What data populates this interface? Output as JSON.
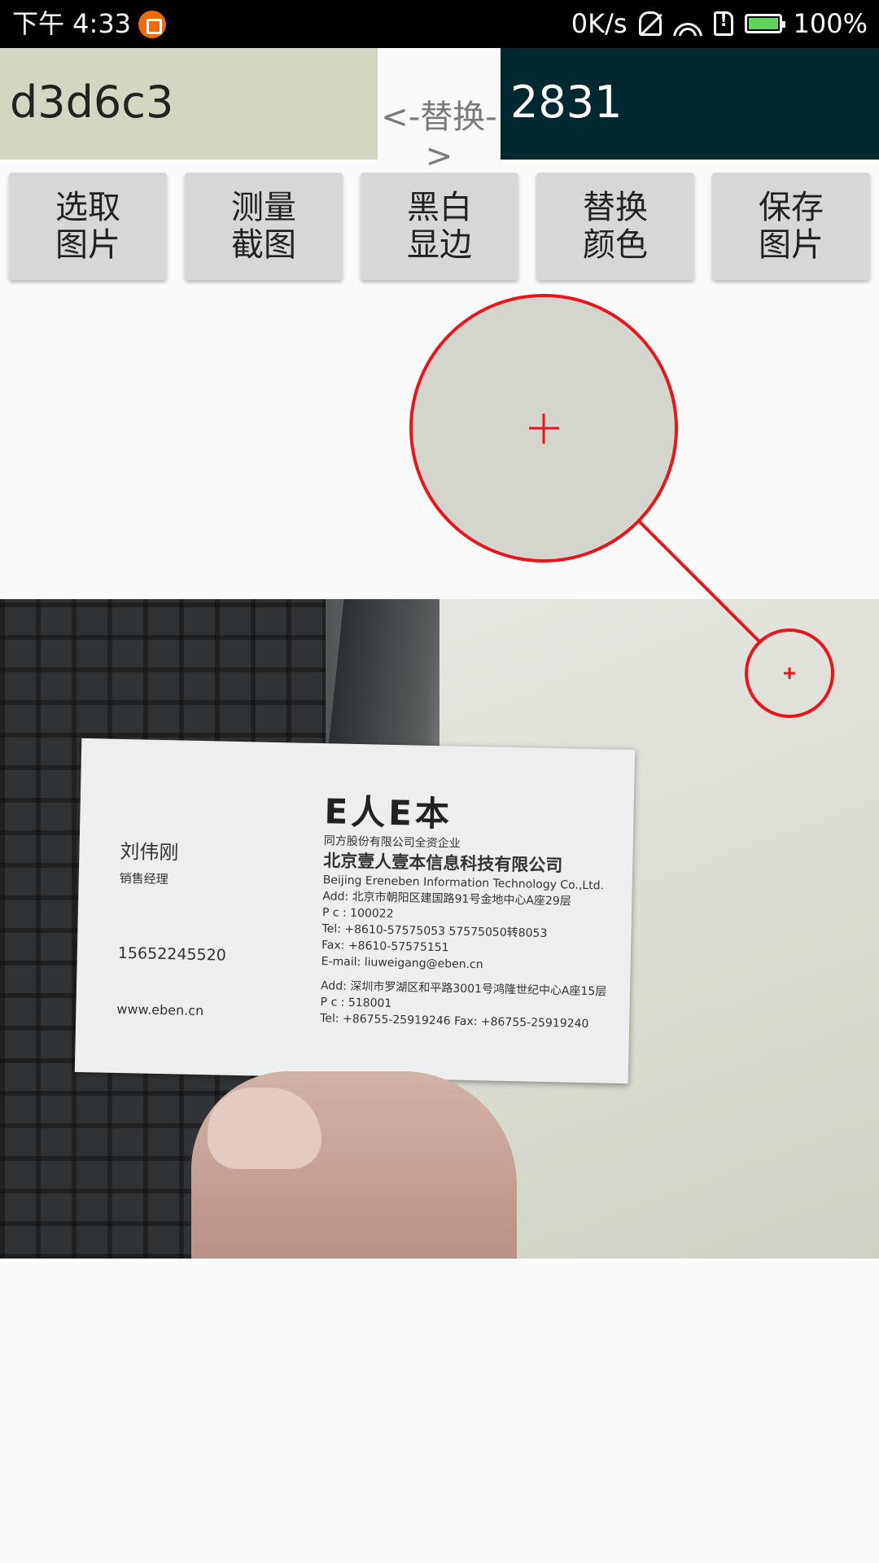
{
  "status_bar": {
    "time": "下午 4:33",
    "net_speed": "0K/s",
    "battery": "100%",
    "battery_level": 1.0,
    "icons": [
      "app-notification-icon",
      "bell-muted-icon",
      "wifi-icon",
      "sim-alert-icon",
      "battery-icon"
    ]
  },
  "colors": {
    "source_hex": "d3d6c3",
    "target_hex": "2831",
    "swap_label": "<-替换->",
    "source_color": "#d3d6c3",
    "target_color": "#002831"
  },
  "toolbar": {
    "buttons": [
      {
        "line1": "选取",
        "line2": "图片"
      },
      {
        "line1": "测量",
        "line2": "截图"
      },
      {
        "line1": "黑白",
        "line2": "显边"
      },
      {
        "line1": "替换",
        "line2": "颜色"
      },
      {
        "line1": "保存",
        "line2": "图片"
      }
    ]
  },
  "business_card": {
    "logo": "E人E本",
    "name": "刘伟刚",
    "title": "销售经理",
    "mobile": "15652245520",
    "website": "www.eben.cn",
    "parent": "同方股份有限公司全资企业",
    "company_cn": "北京壹人壹本信息科技有限公司",
    "company_en": "Beijing Ereneben Information Technology Co.,Ltd.",
    "beijing_add": "Add: 北京市朝阳区建国路91号金地中心A座29层",
    "beijing_pc": "P c : 100022",
    "beijing_tel": "Tel: +8610-57575053    57575050转8053",
    "beijing_fax": "Fax: +8610-57575151",
    "email": "E-mail: liuweigang@eben.cn",
    "shenzhen_add": "Add: 深圳市罗湖区和平路3001号鸿隆世纪中心A座15层",
    "shenzhen_pc": "P c : 518001",
    "shenzhen_telfax": "Tel: +86755-25919246   Fax: +86755-25919240"
  }
}
